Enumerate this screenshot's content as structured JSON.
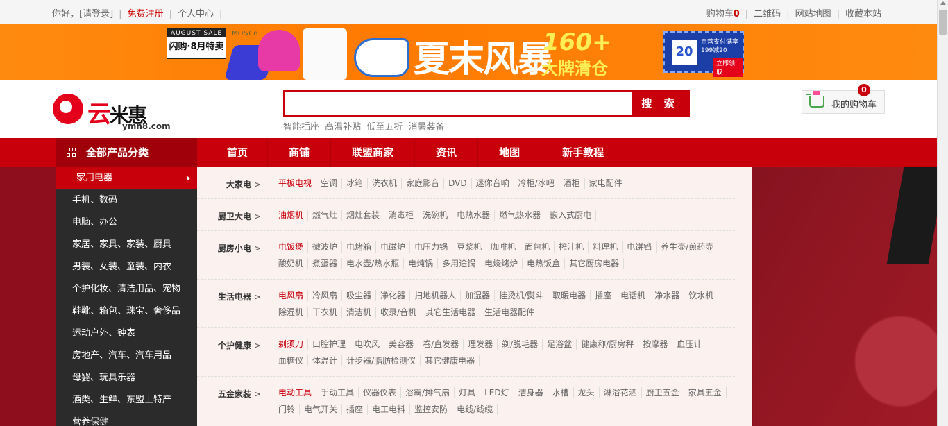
{
  "topbar": {
    "greeting": "你好，",
    "login": "[请登录]",
    "register": "免费注册",
    "user_center": "个人中心",
    "cart": "购物车",
    "cart_count": "0",
    "qrcode": "二维码",
    "sitemap": "网站地图",
    "favorite": "收藏本站"
  },
  "banner": {
    "flash_top": "AUGUST SALE",
    "flash_bottom": "闪购·8月特卖",
    "brand": "MO&Co",
    "headline": "夏末风暴",
    "count": "160+",
    "clearance": "大牌清仓",
    "coupon_value": "20",
    "coupon_text": "自营支付满享199减20",
    "coupon_btn": "立即领取"
  },
  "header": {
    "logo_red": "云",
    "logo_black": "米惠",
    "domain": "ymh8.com",
    "search_placeholder": "",
    "search_btn": "搜 索",
    "hotwords": [
      "智能插座",
      "高温补贴",
      "低至五折",
      "消暑装备"
    ],
    "cart_label": "我的购物车",
    "cart_badge": "0"
  },
  "nav": {
    "all_label": "全部产品分类",
    "items": [
      "首页",
      "商铺",
      "联盟商家",
      "资讯",
      "地图",
      "新手教程"
    ]
  },
  "sidebar": {
    "categories": [
      "家用电器",
      "手机、数码",
      "电脑、办公",
      "家居、家具、家装、厨具",
      "男装、女装、童装、内衣",
      "个护化妆、清洁用品、宠物",
      "鞋靴、箱包、珠宝、奢侈品",
      "运动户外、钟表",
      "房地产、汽车、汽车用品",
      "母婴、玩具乐器",
      "酒类、生鲜、东盟土特产",
      "营养保健"
    ]
  },
  "panel": {
    "rows": [
      {
        "label": "大家电",
        "items": [
          "平板电视",
          "空调",
          "冰箱",
          "洗衣机",
          "家庭影音",
          "DVD",
          "迷你音响",
          "冷柜/冰吧",
          "酒柜",
          "家电配件"
        ]
      },
      {
        "label": "厨卫大电",
        "items": [
          "油烟机",
          "燃气灶",
          "烟灶套装",
          "消毒柜",
          "洗碗机",
          "电热水器",
          "燃气热水器",
          "嵌入式厨电"
        ]
      },
      {
        "label": "厨房小电",
        "items": [
          "电饭煲",
          "微波炉",
          "电烤箱",
          "电磁炉",
          "电压力锅",
          "豆浆机",
          "咖啡机",
          "面包机",
          "榨汁机",
          "料理机",
          "电饼铛",
          "养生壶/煎药壶",
          "酸奶机",
          "煮蛋器",
          "电水壶/热水瓶",
          "电炖锅",
          "多用途锅",
          "电烧烤炉",
          "电热饭盒",
          "其它厨房电器"
        ]
      },
      {
        "label": "生活电器",
        "items": [
          "电风扇",
          "冷风扇",
          "吸尘器",
          "净化器",
          "扫地机器人",
          "加湿器",
          "挂烫机/熨斗",
          "取暖电器",
          "插座",
          "电话机",
          "净水器",
          "饮水机",
          "除湿机",
          "干衣机",
          "清洁机",
          "收录/音机",
          "其它生活电器",
          "生活电器配件"
        ]
      },
      {
        "label": "个护健康",
        "items": [
          "剃须刀",
          "口腔护理",
          "电吹风",
          "美容器",
          "卷/直发器",
          "理发器",
          "剃/脱毛器",
          "足浴盆",
          "健康称/厨房秤",
          "按摩器",
          "血压计",
          "血糖仪",
          "体温计",
          "计步器/脂肪检测仪",
          "其它健康电器"
        ]
      },
      {
        "label": "五金家装",
        "items": [
          "电动工具",
          "手动工具",
          "仪器仪表",
          "浴霸/排气扇",
          "灯具",
          "LED灯",
          "洁身器",
          "水槽",
          "龙头",
          "淋浴花洒",
          "厨卫五金",
          "家具五金",
          "门铃",
          "电气开关",
          "插座",
          "电工电料",
          "监控安防",
          "电线/线缆"
        ]
      }
    ]
  }
}
